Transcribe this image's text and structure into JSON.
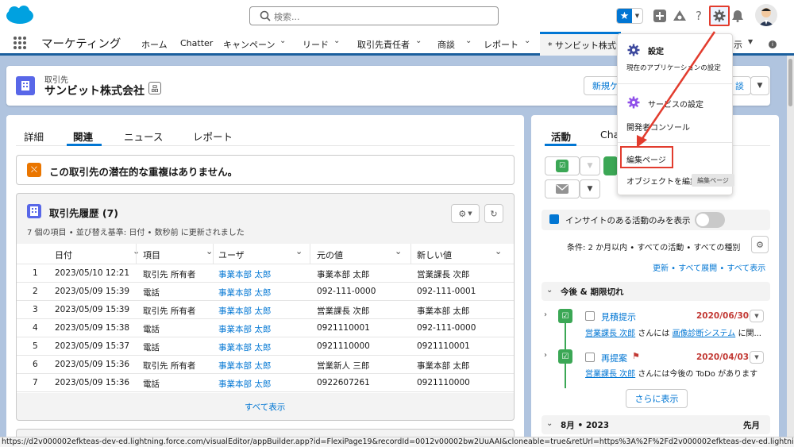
{
  "header": {
    "search_placeholder": "検索...",
    "colors": {
      "brand": "#0176d3",
      "highlight": "#e23c2e"
    }
  },
  "nav": {
    "app_name": "マーケティング",
    "items": [
      {
        "label": "ホーム"
      },
      {
        "label": "Chatter"
      },
      {
        "label": "キャンペーン"
      },
      {
        "label": "リード"
      },
      {
        "label": "取引先責任者"
      },
      {
        "label": "商談"
      },
      {
        "label": "レポート"
      }
    ],
    "active_tab": "* サンビット株式会社",
    "trailing": "示"
  },
  "record": {
    "type": "取引先",
    "name": "サンビット株式会社",
    "buttons": {
      "new_case": "新規ケ",
      "second": "談"
    }
  },
  "left": {
    "tabs": [
      "詳細",
      "関連",
      "ニュース",
      "レポート"
    ],
    "active_tab_index": 1,
    "duplicate_msg": "この取引先の潜在的な重複はありません。",
    "history": {
      "title": "取引先履歴 (7)",
      "subtitle": "7 個の項目 • 並び替え基準: 日付 • 数秒前 に更新されました",
      "columns": [
        "日付",
        "項目",
        "ユーザ",
        "元の値",
        "新しい値"
      ],
      "rows": [
        {
          "n": "1",
          "date": "2023/05/10 12:21",
          "field": "取引先 所有者",
          "user": "事業本部 太郎",
          "old": "事業本部 太郎",
          "new": "営業課長 次郎"
        },
        {
          "n": "2",
          "date": "2023/05/09 15:39",
          "field": "電話",
          "user": "事業本部 太郎",
          "old": "092-111-0000",
          "new": "092-111-0001"
        },
        {
          "n": "3",
          "date": "2023/05/09 15:39",
          "field": "取引先 所有者",
          "user": "事業本部 太郎",
          "old": "営業課長 次郎",
          "new": "事業本部 太郎"
        },
        {
          "n": "4",
          "date": "2023/05/09 15:38",
          "field": "電話",
          "user": "事業本部 太郎",
          "old": "0921110001",
          "new": "092-111-0000"
        },
        {
          "n": "5",
          "date": "2023/05/09 15:37",
          "field": "電話",
          "user": "事業本部 太郎",
          "old": "0921110000",
          "new": "0921110001"
        },
        {
          "n": "6",
          "date": "2023/05/09 15:36",
          "field": "取引先 所有者",
          "user": "事業本部 太郎",
          "old": "営業新人 三郎",
          "new": "事業本部 太郎"
        },
        {
          "n": "7",
          "date": "2023/05/09 15:36",
          "field": "電話",
          "user": "事業本部 太郎",
          "old": "0922607261",
          "new": "0921110000"
        }
      ],
      "show_all": "すべて表示"
    }
  },
  "right": {
    "tabs": [
      "活動",
      "Cha"
    ],
    "insight": "インサイトのある活動のみを表示",
    "condition": "条件: 2 か月以内 • すべての活動 • すべての種別",
    "links": "更新 • すべて展開 • すべて表示",
    "upcoming": "今後 & 期限切れ",
    "tasks": [
      {
        "title": "見積提示",
        "date": "2020/06/30",
        "who": "営業課長 次郎",
        "mid": "さんには",
        "what": "画像診断システム",
        "tail": "に関..."
      },
      {
        "title": "再提案",
        "date": "2020/04/03",
        "who": "営業課長 次郎",
        "mid": "さんには今後の ToDo があります",
        "what": "",
        "tail": ""
      }
    ],
    "more": "さらに表示",
    "month": "8月 • 2023",
    "month_right": "先月"
  },
  "menu": {
    "settings_title": "設定",
    "settings_sub": "現在のアプリケーションの設定",
    "service_settings": "サービスの設定",
    "dev_console": "開発者コンソール",
    "edit_page": "編集ページ",
    "object_edit": "オブジェクトを編集",
    "tooltip": "編集ページ"
  },
  "status_url": "https://d2v000002efkteas-dev-ed.lightning.force.com/visualEditor/appBuilder.app?id=FlexiPage19&recordId=0012v00002bw2UuAAI&cloneable=true&retUrl=https%3A%2F%2Fd2v000002efkteas-dev-ed.lightning.force..."
}
